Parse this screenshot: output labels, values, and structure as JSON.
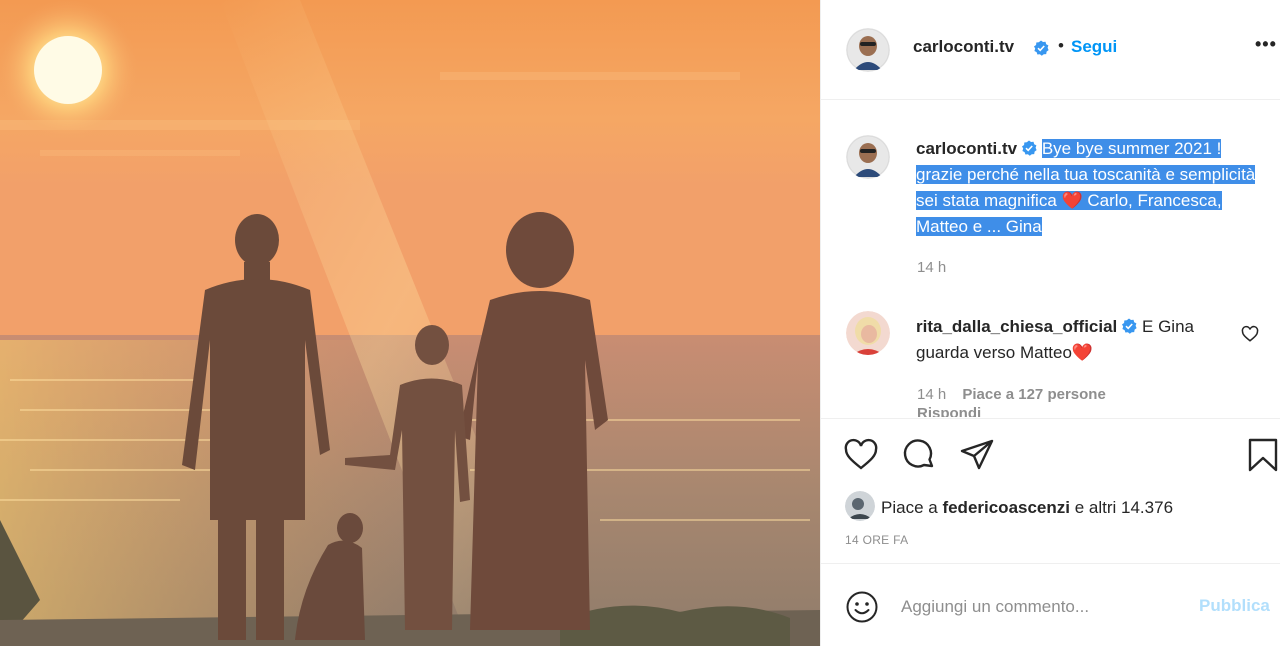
{
  "post": {
    "author": "carloconti.tv",
    "follow_separator": "•",
    "follow_label": "Segui",
    "more_label": "•••"
  },
  "caption": {
    "author": "carloconti.tv",
    "text": "Bye bye summer 2021 ! grazie perché nella tua toscanità e semplicità sei stata magnifica ❤️ Carlo, Francesca, Matteo e ... Gina",
    "time": "14 h"
  },
  "comment": {
    "author": "rita_dalla_chiesa_official",
    "text": "E Gina guarda verso Matteo❤️",
    "time": "14 h",
    "likes": "Piace a 127 persone",
    "reply_label": "Rispondi"
  },
  "likes_row": {
    "prefix": "Piace a",
    "user": "federicoascenzi",
    "suffix": "e altri 14.376"
  },
  "timestamp": "14 ORE FA",
  "add_comment": {
    "placeholder": "Aggiungi un commento...",
    "publish_label": "Pubblica"
  },
  "colors": {
    "link": "#0095f6",
    "publish_disabled": "#b2dffc",
    "selection": "#3f8ee8",
    "verified": "#3897f0",
    "heart": "#ed4956"
  },
  "icons": [
    "heart-icon",
    "comment-icon",
    "share-icon",
    "bookmark-icon",
    "emoji-icon",
    "verified-icon",
    "more-icon"
  ]
}
